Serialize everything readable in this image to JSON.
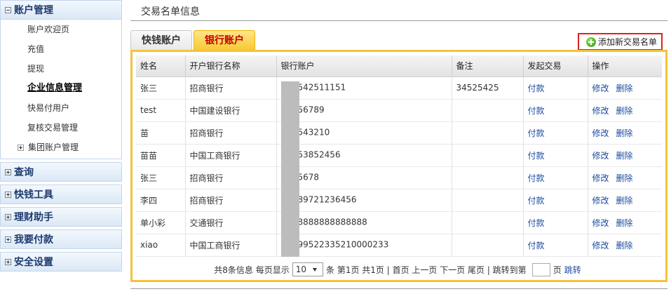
{
  "sidebar": {
    "account_mgmt": {
      "label": "账户管理",
      "items": [
        "账户欢迎页",
        "充值",
        "提现",
        "企业信息管理",
        "快易付用户",
        "复核交易管理",
        "集团账户管理"
      ]
    },
    "groups": [
      "查询",
      "快钱工具",
      "理财助手",
      "我要付款",
      "安全设置"
    ]
  },
  "main": {
    "title": "交易名单信息",
    "tabs": [
      "快钱账户",
      "银行账户"
    ],
    "add_label": "添加新交易名单"
  },
  "table": {
    "headers": [
      "姓名",
      "开户银行名称",
      "银行账户",
      "备注",
      "发起交易",
      "操作"
    ],
    "rows": [
      {
        "name": "张三",
        "bank": "招商银行",
        "account": "542511151",
        "note": "34525425"
      },
      {
        "name": "test",
        "bank": "中国建设银行",
        "account": "56789",
        "note": ""
      },
      {
        "name": "苗",
        "bank": "招商银行",
        "account": "543210",
        "note": ""
      },
      {
        "name": "苗苗",
        "bank": "中国工商银行",
        "account": "53852456",
        "note": ""
      },
      {
        "name": "张三",
        "bank": "招商银行",
        "account": "5678",
        "note": ""
      },
      {
        "name": "李四",
        "bank": "招商银行",
        "account": "89721236456",
        "note": ""
      },
      {
        "name": "单小彩",
        "bank": "交通银行",
        "account": "8888888888888",
        "note": ""
      },
      {
        "name": "xiao",
        "bank": "中国工商银行",
        "account": "99522335210000233",
        "note": ""
      }
    ],
    "pay_label": "付款",
    "edit_label": "修改",
    "delete_label": "删除"
  },
  "pager": {
    "summary": "共8条信息 每页显示",
    "page_size": "10",
    "after_size": "条 第1页 共1页 | 首页 上一页 下一页 尾页 | 跳转到第",
    "page_unit": "页",
    "jump_label": "跳转"
  },
  "colors": {
    "panel_border": "#f5c23b",
    "active_tab_text": "#c00000",
    "link": "#1a4b9c",
    "add_button_border": "#e02020"
  }
}
